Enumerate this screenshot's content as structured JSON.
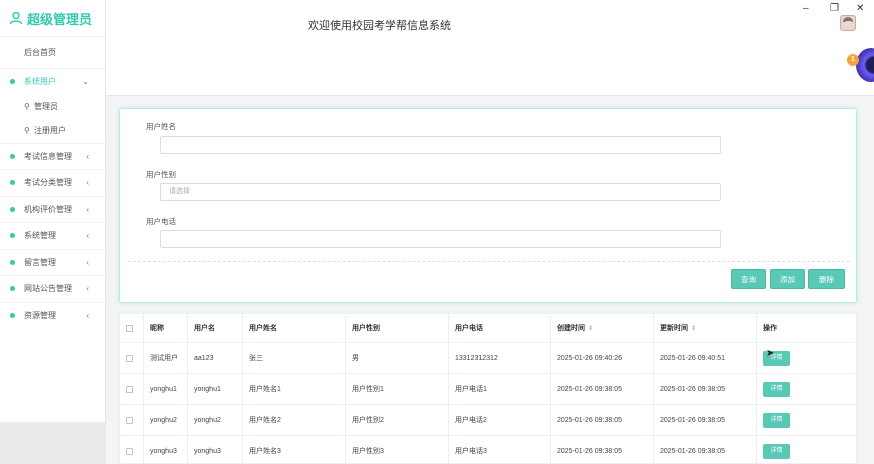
{
  "app": {
    "brand": "超级管理员",
    "title": "欢迎使用校园考学帮信息系统",
    "notification_count": "1"
  },
  "window": {
    "minimize": "–",
    "restore": "❐",
    "close": "✕"
  },
  "sidebar": {
    "home": "后台首页",
    "groups": [
      {
        "label": "系统用户",
        "active": true,
        "chev": "⌄"
      },
      {
        "label": "考试信息管理",
        "chev": "‹"
      },
      {
        "label": "考试分类管理",
        "chev": "‹"
      },
      {
        "label": "机构评价管理",
        "chev": "‹"
      },
      {
        "label": "系统管理",
        "chev": "‹"
      },
      {
        "label": "留言管理",
        "chev": "‹"
      },
      {
        "label": "网站公告管理",
        "chev": "‹"
      },
      {
        "label": "资源管理",
        "chev": "‹"
      }
    ],
    "sub_items": [
      {
        "label": "管理员"
      },
      {
        "label": "注册用户"
      }
    ]
  },
  "search": {
    "name_label": "用户姓名",
    "name_value": "",
    "gender_label": "用户性别",
    "gender_placeholder": "请选择",
    "phone_label": "用户电话",
    "phone_value": "",
    "buttons": {
      "query": "查询",
      "add": "添加",
      "delete": "删除"
    }
  },
  "table": {
    "columns": [
      "昵称",
      "用户名",
      "用户姓名",
      "用户性别",
      "用户电话",
      "创建时间",
      "更新时间",
      "操作"
    ],
    "rows": [
      {
        "nickname": "测试用户",
        "username": "aa123",
        "realname": "张三",
        "gender": "男",
        "phone": "13312312312",
        "created": "2025-01-26 09:40:26",
        "updated": "2025-01-26 09:40:51",
        "action": "详情"
      },
      {
        "nickname": "yonghu1",
        "username": "yonghu1",
        "realname": "用户姓名1",
        "gender": "用户性别1",
        "phone": "用户电话1",
        "created": "2025-01-26 09:38:05",
        "updated": "2025-01-26 09:38:05",
        "action": "详情"
      },
      {
        "nickname": "yonghu2",
        "username": "yonghu2",
        "realname": "用户姓名2",
        "gender": "用户性别2",
        "phone": "用户电话2",
        "created": "2025-01-26 09:38:05",
        "updated": "2025-01-26 09:38:05",
        "action": "详情"
      },
      {
        "nickname": "yonghu3",
        "username": "yonghu3",
        "realname": "用户姓名3",
        "gender": "用户性别3",
        "phone": "用户电话3",
        "created": "2025-01-26 09:38:05",
        "updated": "2025-01-26 09:38:05",
        "action": "详情"
      }
    ]
  },
  "colors": {
    "accent": "#34c9b0",
    "button": "#57c9b4",
    "badge": "#f7a33a"
  },
  "icons": {
    "brand": "user-icon",
    "sub": "user-outline-icon",
    "sort": "sort-icon"
  }
}
